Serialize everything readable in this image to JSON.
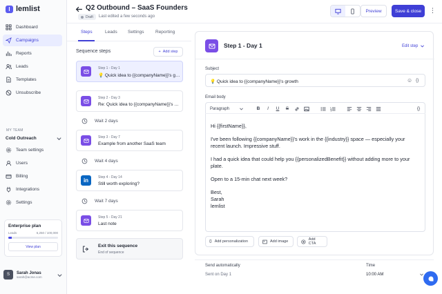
{
  "app": {
    "name": "lemlist",
    "brand_color": "#5b5bf0"
  },
  "sidebar": {
    "items": [
      {
        "label": "Dashboard",
        "icon": "grid-icon"
      },
      {
        "label": "Campaigns",
        "icon": "send-icon",
        "active": true
      },
      {
        "label": "Reports",
        "icon": "chart-icon"
      },
      {
        "label": "Leads",
        "icon": "users-icon"
      },
      {
        "label": "Templates",
        "icon": "file-icon"
      },
      {
        "label": "Unsubscribe",
        "icon": "ban-icon"
      }
    ],
    "team_label": "MY TEAM",
    "team_name": "Cold Outreach",
    "team_items": [
      {
        "label": "Team settings",
        "icon": "gear-icon"
      },
      {
        "label": "Users",
        "icon": "user-icon"
      },
      {
        "label": "Billing",
        "icon": "card-icon"
      },
      {
        "label": "Integrations",
        "icon": "plug-icon"
      },
      {
        "label": "Settings",
        "icon": "gear-icon"
      }
    ],
    "plan": {
      "title": "Enterprise plan",
      "leads_label": "Leads",
      "leads_value": "6,250 / 100,000",
      "progress": 0.0625,
      "button": "View plan"
    },
    "user": {
      "initial": "S",
      "name": "Sarah Jonas",
      "email": "sarah@acme.com"
    }
  },
  "header": {
    "title": "Q2 Outbound – SaaS Founders",
    "badge": "Draft",
    "edited": "Last edited a few seconds ago",
    "preview": "Preview",
    "save": "Save & close"
  },
  "tabs": [
    "Steps",
    "Leads",
    "Settings",
    "Reporting"
  ],
  "sequence": {
    "label": "Sequence steps",
    "add_step": "Add step",
    "steps": [
      {
        "meta": "Step 1 - Day 1",
        "title": "💡 Quick idea to {{companyName}}'s growth",
        "type": "email",
        "active": true
      },
      {
        "meta": "Step 2 - Day 3",
        "title": "Re: Quick idea to {{companyName}}'s growth",
        "type": "email"
      },
      {
        "meta": "Step 3 - Day 7",
        "title": "Example from another SaaS team",
        "type": "email"
      },
      {
        "meta": "Step 4 - Day 14",
        "title": "Still worth exploring?",
        "type": "linkedin"
      },
      {
        "meta": "Step 5 - Day 21",
        "title": "Last note",
        "type": "email"
      }
    ],
    "waits": [
      "Wait 2 days",
      "Wait 4 days",
      "Wait 7 days"
    ],
    "exit": {
      "title": "Exit this sequence",
      "sub": "End of sequence"
    }
  },
  "editor": {
    "step_title": "Step 1 - Day 1",
    "edit_step": "Edit step",
    "subject_label": "Subject",
    "subject": "💡 Quick idea to {{companyName}}'s growth",
    "body_label": "Email body",
    "paragraph": "Paragraph",
    "body": [
      "Hi {{firstName}},",
      "I've been following {{companyName}}'s work in the {{industry}} space — especially your recent launch. Impressive stuff.",
      "I had a quick idea that could help you {{personalizedBenefit}} without adding more to your plate.",
      "Open to a 15-min chat next week?",
      "Best,\nSarah\nlemlist"
    ],
    "actions": [
      "Add personalization",
      "Add image",
      "Add CTA"
    ],
    "send_label": "Send automatically",
    "send_value": "Sent on Day 1",
    "time_label": "Time",
    "time_value": "10:00 AM"
  }
}
